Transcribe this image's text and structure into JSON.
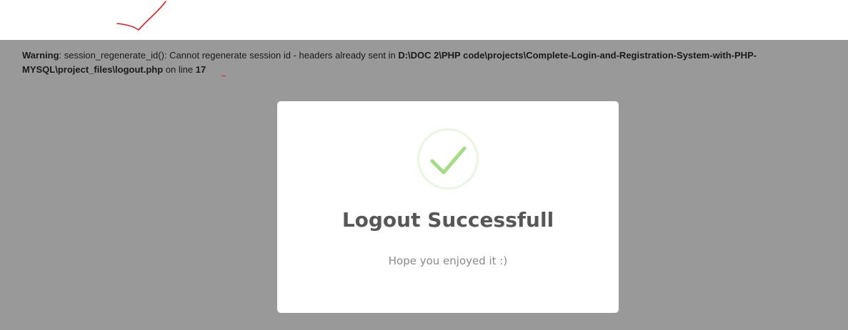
{
  "warning": {
    "label": "Warning",
    "sep1": ": ",
    "message": "session_regenerate_id(): Cannot regenerate session id - headers already sent in ",
    "path": "D:\\DOC 2\\PHP code\\projects\\Complete-Login-and-Registration-System-with-PHP-MYSQL\\project_files\\logout.php",
    "online": " on line ",
    "line": "17"
  },
  "modal": {
    "icon": "success-check-icon",
    "title": "Logout Successfull",
    "text": "Hope you enjoyed it :)"
  },
  "colors": {
    "overlay": "#999999",
    "success": "#a5dc86",
    "annotation": "#e02020"
  }
}
